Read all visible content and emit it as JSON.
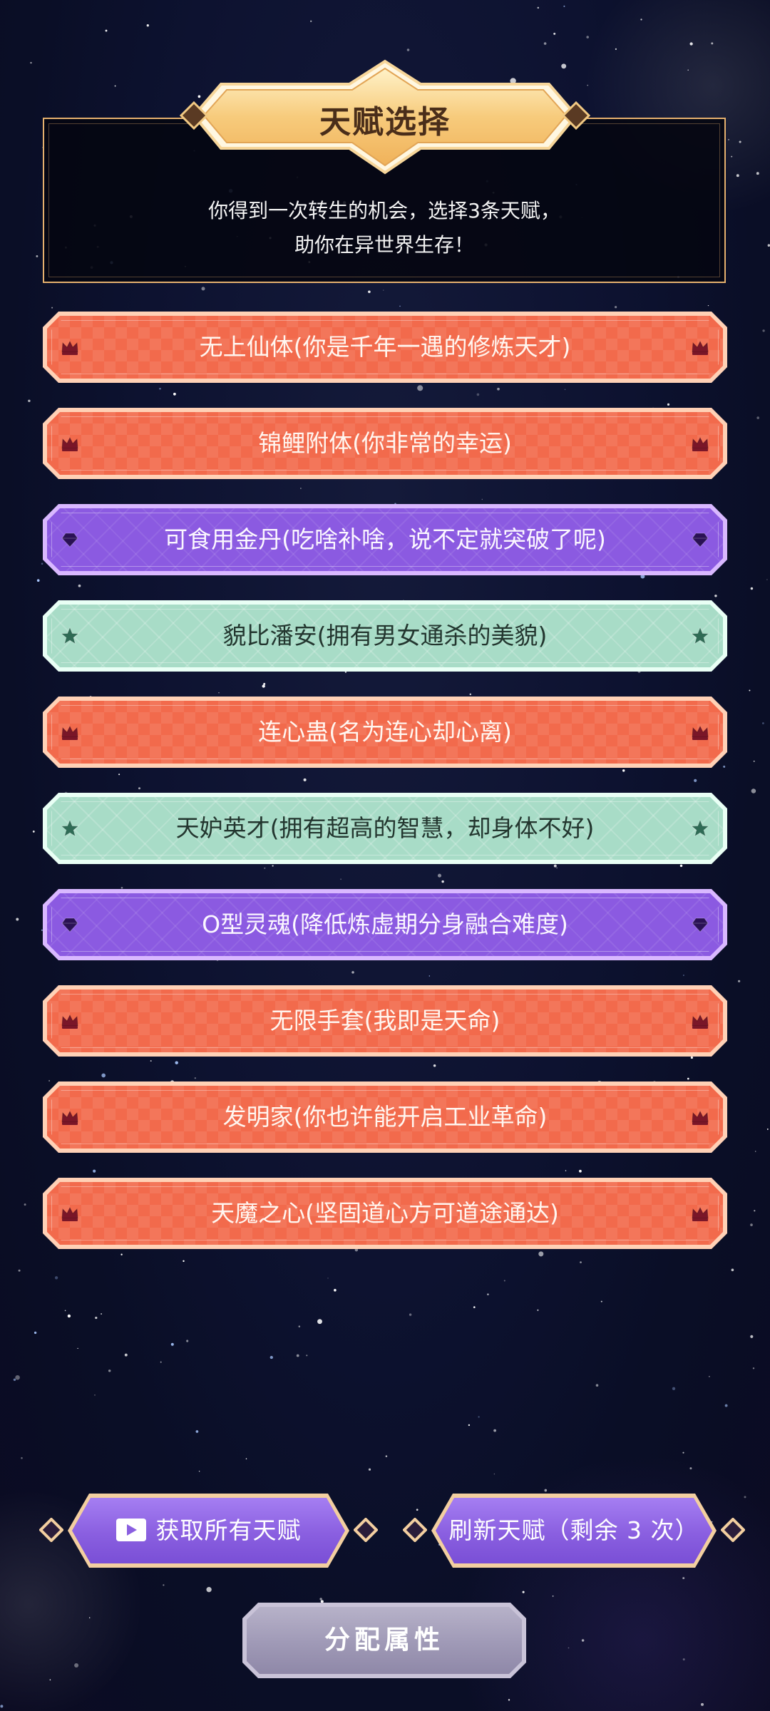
{
  "header": {
    "title": "天赋选择",
    "description_line1": "你得到一次转生的机会，选择3条天赋，",
    "description_line2": "助你在异世界生存！"
  },
  "talents": [
    {
      "type": "red",
      "icon": "crown-icon",
      "label": "无上仙体(你是千年一遇的修炼天才)"
    },
    {
      "type": "red",
      "icon": "crown-icon",
      "label": "锦鲤附体(你非常的幸运)"
    },
    {
      "type": "purple",
      "icon": "diamond-icon",
      "label": "可食用金丹(吃啥补啥，说不定就突破了呢)"
    },
    {
      "type": "green",
      "icon": "star-icon",
      "label": "貌比潘安(拥有男女通杀的美貌)"
    },
    {
      "type": "red",
      "icon": "crown-icon",
      "label": "连心蛊(名为连心却心离)"
    },
    {
      "type": "green",
      "icon": "star-icon",
      "label": "天妒英才(拥有超高的智慧，却身体不好)"
    },
    {
      "type": "purple",
      "icon": "diamond-icon",
      "label": "O型灵魂(降低炼虚期分身融合难度)"
    },
    {
      "type": "red",
      "icon": "crown-icon",
      "label": "无限手套(我即是天命)"
    },
    {
      "type": "red",
      "icon": "crown-icon",
      "label": "发明家(你也许能开启工业革命)"
    },
    {
      "type": "red",
      "icon": "crown-icon",
      "label": "天魔之心(坚固道心方可道途通达)"
    }
  ],
  "buttons": {
    "get_all": "获取所有天赋",
    "refresh": "刷新天赋（剩余 3 次）",
    "allocate": "分配属性"
  },
  "colors": {
    "red": "#f26a4c",
    "purple": "#8b5ae1",
    "green": "#a8dcc7",
    "gold": "#e5b06e",
    "button_purple": "#8a5fe0",
    "button_gray": "#9f99b6"
  }
}
